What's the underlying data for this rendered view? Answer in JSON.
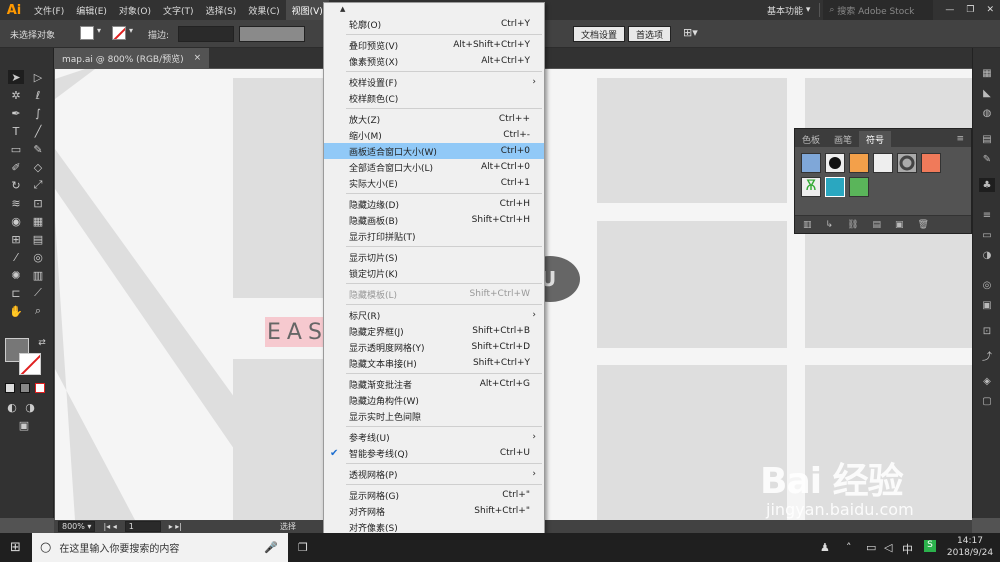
{
  "app": {
    "logo": "Ai",
    "menu": [
      "文件(F)",
      "编辑(E)",
      "对象(O)",
      "文字(T)",
      "选择(S)",
      "效果(C)",
      "视图(V)"
    ],
    "workspace": "基本功能",
    "search_placeholder": "搜索 Adobe Stock"
  },
  "options_bar": {
    "selection": "未选择对象",
    "stroke_label": "描边:",
    "doc_settings": "文档设置",
    "preferences": "首选项"
  },
  "document_tab": {
    "title": "map.ai @ 800% (RGB/预览)",
    "close": "×"
  },
  "canvas": {
    "text": "EAS",
    "oval_letter": "U"
  },
  "symbols_panel": {
    "tabs": [
      "色板",
      "画笔",
      "符号"
    ],
    "active_tab": "符号"
  },
  "status_bar": {
    "zoom": "800%",
    "artboard": "1",
    "tool": "选择"
  },
  "view_menu": {
    "items": [
      {
        "label": "轮廓(O)",
        "shortcut": "Ctrl+Y"
      },
      {
        "label": "叠印预览(V)",
        "shortcut": "Alt+Shift+Ctrl+Y"
      },
      {
        "label": "像素预览(X)",
        "shortcut": "Alt+Ctrl+Y"
      },
      {
        "label": "校样设置(F)",
        "shortcut": "",
        "submenu": true
      },
      {
        "label": "校样颜色(C)",
        "shortcut": ""
      },
      {
        "label": "放大(Z)",
        "shortcut": "Ctrl++"
      },
      {
        "label": "缩小(M)",
        "shortcut": "Ctrl+-"
      },
      {
        "label": "画板适合窗口大小(W)",
        "shortcut": "Ctrl+0",
        "highlight": true
      },
      {
        "label": "全部适合窗口大小(L)",
        "shortcut": "Alt+Ctrl+0"
      },
      {
        "label": "实际大小(E)",
        "shortcut": "Ctrl+1"
      },
      {
        "label": "隐藏边缘(D)",
        "shortcut": "Ctrl+H"
      },
      {
        "label": "隐藏画板(B)",
        "shortcut": "Shift+Ctrl+H"
      },
      {
        "label": "显示打印拼贴(T)",
        "shortcut": ""
      },
      {
        "label": "显示切片(S)",
        "shortcut": ""
      },
      {
        "label": "锁定切片(K)",
        "shortcut": ""
      },
      {
        "label": "隐藏模板(L)",
        "shortcut": "Shift+Ctrl+W",
        "disabled": true
      },
      {
        "label": "标尺(R)",
        "shortcut": "",
        "submenu": true
      },
      {
        "label": "隐藏定界框(J)",
        "shortcut": "Shift+Ctrl+B"
      },
      {
        "label": "显示透明度网格(Y)",
        "shortcut": "Shift+Ctrl+D"
      },
      {
        "label": "隐藏文本串接(H)",
        "shortcut": "Shift+Ctrl+Y"
      },
      {
        "label": "隐藏渐变批注者",
        "shortcut": "Alt+Ctrl+G"
      },
      {
        "label": "隐藏边角构件(W)",
        "shortcut": ""
      },
      {
        "label": "显示实时上色间隙",
        "shortcut": ""
      },
      {
        "label": "参考线(U)",
        "shortcut": "",
        "submenu": true
      },
      {
        "label": "智能参考线(Q)",
        "shortcut": "Ctrl+U",
        "checked": true
      },
      {
        "label": "透视网格(P)",
        "shortcut": "",
        "submenu": true
      },
      {
        "label": "显示网格(G)",
        "shortcut": "Ctrl+\""
      },
      {
        "label": "对齐网格",
        "shortcut": "Shift+Ctrl+\""
      },
      {
        "label": "对齐像素(S)",
        "shortcut": ""
      }
    ]
  },
  "taskbar": {
    "search_placeholder": "在这里输入你要搜索的内容",
    "time": "14:17",
    "date": "2018/9/24"
  },
  "watermark": {
    "brand": "Bai 经验",
    "url": "jingyan.baidu.com"
  },
  "colors": {
    "menu_highlight": "#91c9f7",
    "canvas_text_bg": "#f6c9cf",
    "app_accent": "#ff9a00"
  }
}
